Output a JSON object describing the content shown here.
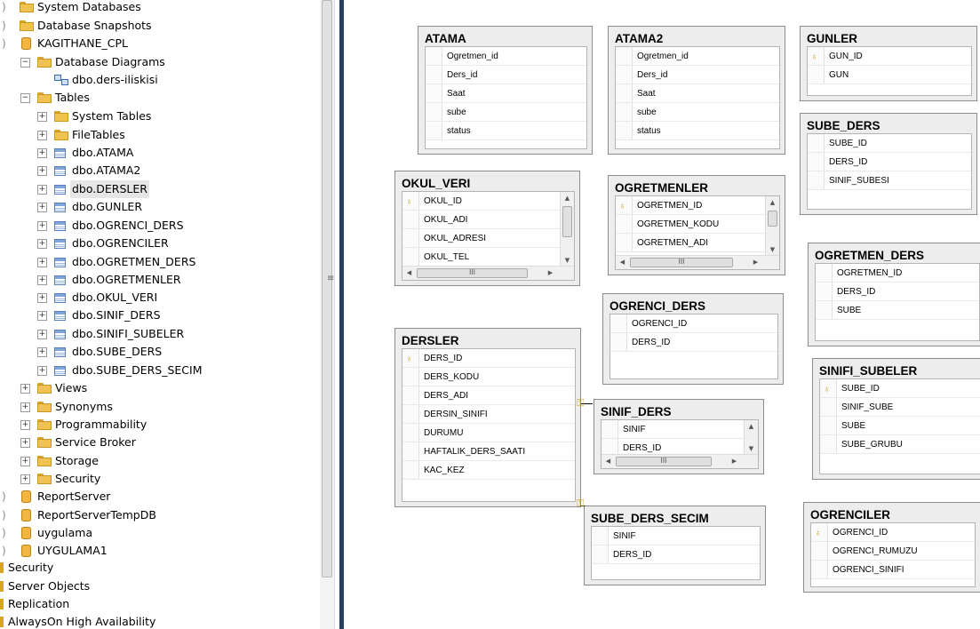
{
  "explorer": {
    "items": [
      {
        "label": "System Databases",
        "icon": "folder-icon"
      },
      {
        "label": "Database Snapshots",
        "icon": "folder-icon"
      },
      {
        "label": "KAGITHANE_CPL",
        "icon": "database-icon"
      },
      {
        "label": "Database Diagrams",
        "icon": "folder-icon",
        "expander": "−"
      },
      {
        "label": "dbo.ders-iliskisi",
        "icon": "diagram-icon"
      },
      {
        "label": "Tables",
        "icon": "folder-icon",
        "expander": "−"
      },
      {
        "label": "System Tables",
        "icon": "folder-icon",
        "expander": "+"
      },
      {
        "label": "FileTables",
        "icon": "folder-icon",
        "expander": "+"
      },
      {
        "label": "dbo.ATAMA",
        "icon": "table-icon",
        "expander": "+"
      },
      {
        "label": "dbo.ATAMA2",
        "icon": "table-icon",
        "expander": "+"
      },
      {
        "label": "dbo.DERSLER",
        "icon": "table-icon",
        "expander": "+",
        "selected": true
      },
      {
        "label": "dbo.GUNLER",
        "icon": "table-icon",
        "expander": "+"
      },
      {
        "label": "dbo.OGRENCI_DERS",
        "icon": "table-icon",
        "expander": "+"
      },
      {
        "label": "dbo.OGRENCILER",
        "icon": "table-icon",
        "expander": "+"
      },
      {
        "label": "dbo.OGRETMEN_DERS",
        "icon": "table-icon",
        "expander": "+"
      },
      {
        "label": "dbo.OGRETMENLER",
        "icon": "table-icon",
        "expander": "+"
      },
      {
        "label": "dbo.OKUL_VERI",
        "icon": "table-icon",
        "expander": "+"
      },
      {
        "label": "dbo.SINIF_DERS",
        "icon": "table-icon",
        "expander": "+"
      },
      {
        "label": "dbo.SINIFI_SUBELER",
        "icon": "table-icon",
        "expander": "+"
      },
      {
        "label": "dbo.SUBE_DERS",
        "icon": "table-icon",
        "expander": "+"
      },
      {
        "label": "dbo.SUBE_DERS_SECIM",
        "icon": "table-icon",
        "expander": "+"
      },
      {
        "label": "Views",
        "icon": "folder-icon",
        "expander": "+"
      },
      {
        "label": "Synonyms",
        "icon": "folder-icon",
        "expander": "+"
      },
      {
        "label": "Programmability",
        "icon": "folder-icon",
        "expander": "+"
      },
      {
        "label": "Service Broker",
        "icon": "folder-icon",
        "expander": "+"
      },
      {
        "label": "Storage",
        "icon": "folder-icon",
        "expander": "+"
      },
      {
        "label": "Security",
        "icon": "folder-icon",
        "expander": "+"
      },
      {
        "label": "ReportServer",
        "icon": "database-icon"
      },
      {
        "label": "ReportServerTempDB",
        "icon": "database-icon"
      },
      {
        "label": "uygulama",
        "icon": "database-icon"
      },
      {
        "label": "UYGULAMA1",
        "icon": "database-icon"
      },
      {
        "label": "Security",
        "icon": "folder-icon"
      },
      {
        "label": "Server Objects",
        "icon": "folder-icon"
      },
      {
        "label": "Replication",
        "icon": "folder-icon"
      },
      {
        "label": "AlwaysOn High Availability",
        "icon": "folder-icon"
      }
    ]
  },
  "diagram": {
    "scroll_glyph": "III",
    "tables": [
      {
        "name": "ATAMA",
        "columns": [
          {
            "name": "Ogretmen_id"
          },
          {
            "name": "Ders_id"
          },
          {
            "name": "Saat"
          },
          {
            "name": "sube"
          },
          {
            "name": "status"
          }
        ]
      },
      {
        "name": "ATAMA2",
        "columns": [
          {
            "name": "Ogretmen_id"
          },
          {
            "name": "Ders_id"
          },
          {
            "name": "Saat"
          },
          {
            "name": "sube"
          },
          {
            "name": "status"
          }
        ]
      },
      {
        "name": "GUNLER",
        "columns": [
          {
            "name": "GUN_ID",
            "pk": true
          },
          {
            "name": "GUN"
          }
        ]
      },
      {
        "name": "SUBE_DERS",
        "columns": [
          {
            "name": "SUBE_ID"
          },
          {
            "name": "DERS_ID"
          },
          {
            "name": "SINIF_SUBESI"
          }
        ]
      },
      {
        "name": "OKUL_VERI",
        "columns": [
          {
            "name": "OKUL_ID",
            "pk": true
          },
          {
            "name": "OKUL_ADI"
          },
          {
            "name": "OKUL_ADRESI"
          },
          {
            "name": "OKUL_TEL"
          }
        ]
      },
      {
        "name": "OGRETMENLER",
        "columns": [
          {
            "name": "OGRETMEN_ID",
            "pk": true
          },
          {
            "name": "OGRETMEN_KODU"
          },
          {
            "name": "OGRETMEN_ADI"
          }
        ]
      },
      {
        "name": "OGRETMEN_DERS",
        "columns": [
          {
            "name": "OGRETMEN_ID"
          },
          {
            "name": "DERS_ID"
          },
          {
            "name": "SUBE"
          }
        ]
      },
      {
        "name": "OGRENCI_DERS",
        "columns": [
          {
            "name": "OGRENCI_ID"
          },
          {
            "name": "DERS_ID"
          }
        ]
      },
      {
        "name": "DERSLER",
        "columns": [
          {
            "name": "DERS_ID",
            "pk": true
          },
          {
            "name": "DERS_KODU"
          },
          {
            "name": "DERS_ADI"
          },
          {
            "name": "DERSIN_SINIFI"
          },
          {
            "name": "DURUMU"
          },
          {
            "name": "HAFTALIK_DERS_SAATI"
          },
          {
            "name": "KAC_KEZ"
          }
        ]
      },
      {
        "name": "SINIF_DERS",
        "columns": [
          {
            "name": "SINIF"
          },
          {
            "name": "DERS_ID"
          }
        ]
      },
      {
        "name": "SINIFI_SUBELER",
        "columns": [
          {
            "name": "SUBE_ID",
            "pk": true
          },
          {
            "name": "SINIF_SUBE"
          },
          {
            "name": "SUBE"
          },
          {
            "name": "SUBE_GRUBU"
          }
        ]
      },
      {
        "name": "SUBE_DERS_SECIM",
        "columns": [
          {
            "name": "SINIF"
          },
          {
            "name": "DERS_ID"
          }
        ]
      },
      {
        "name": "OGRENCILER",
        "columns": [
          {
            "name": "OGRENCI_ID",
            "pk": true
          },
          {
            "name": "OGRENCI_RUMUZU"
          },
          {
            "name": "OGRENCI_SINIFI"
          }
        ]
      }
    ]
  }
}
